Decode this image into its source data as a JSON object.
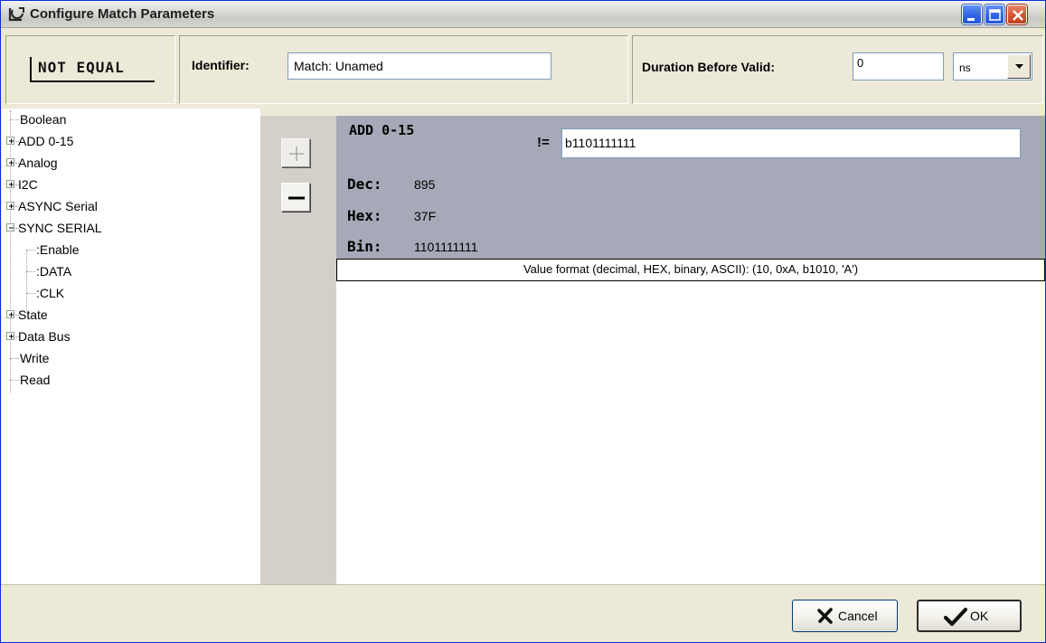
{
  "window": {
    "title": "Configure Match Parameters"
  },
  "toolbar": {
    "operator_label": "NOT EQUAL",
    "identifier_label": "Identifier:",
    "identifier_value": "Match: Unamed",
    "duration_label": "Duration Before Valid:",
    "duration_value": "0",
    "duration_unit": "ns"
  },
  "tree": {
    "items": [
      {
        "label": "Boolean",
        "expandable": false,
        "level": 0
      },
      {
        "label": "ADD 0-15",
        "expandable": true,
        "expanded": false,
        "level": 0
      },
      {
        "label": "Analog",
        "expandable": true,
        "expanded": false,
        "level": 0
      },
      {
        "label": "I2C",
        "expandable": true,
        "expanded": false,
        "level": 0
      },
      {
        "label": "ASYNC Serial",
        "expandable": true,
        "expanded": false,
        "level": 0
      },
      {
        "label": "SYNC SERIAL",
        "expandable": true,
        "expanded": true,
        "level": 0
      },
      {
        "label": ":Enable",
        "expandable": false,
        "level": 1
      },
      {
        "label": ":DATA",
        "expandable": false,
        "level": 1
      },
      {
        "label": ":CLK",
        "expandable": false,
        "level": 1
      },
      {
        "label": "State",
        "expandable": true,
        "expanded": false,
        "level": 0
      },
      {
        "label": "Data Bus",
        "expandable": true,
        "expanded": false,
        "level": 0
      },
      {
        "label": "Write",
        "expandable": false,
        "level": 0
      },
      {
        "label": "Read",
        "expandable": false,
        "level": 0
      }
    ]
  },
  "editor": {
    "signal_name": "ADD 0-15",
    "operator": "!=",
    "value": "b1101111111",
    "dec_label": "Dec:",
    "dec_value": "895",
    "hex_label": "Hex:",
    "hex_value": "37F",
    "bin_label": "Bin:",
    "bin_value": "1101111111",
    "format_hint": "Value format (decimal, HEX, binary, ASCII):  (10, 0xA, b1010, 'A')"
  },
  "buttons": {
    "cancel_label": "Cancel",
    "ok_label": "OK"
  },
  "icons": {
    "title": "logic-probe-icon",
    "add": "plus-icon",
    "remove": "minus-icon",
    "cancel": "x-icon",
    "ok": "checkmark-icon"
  }
}
